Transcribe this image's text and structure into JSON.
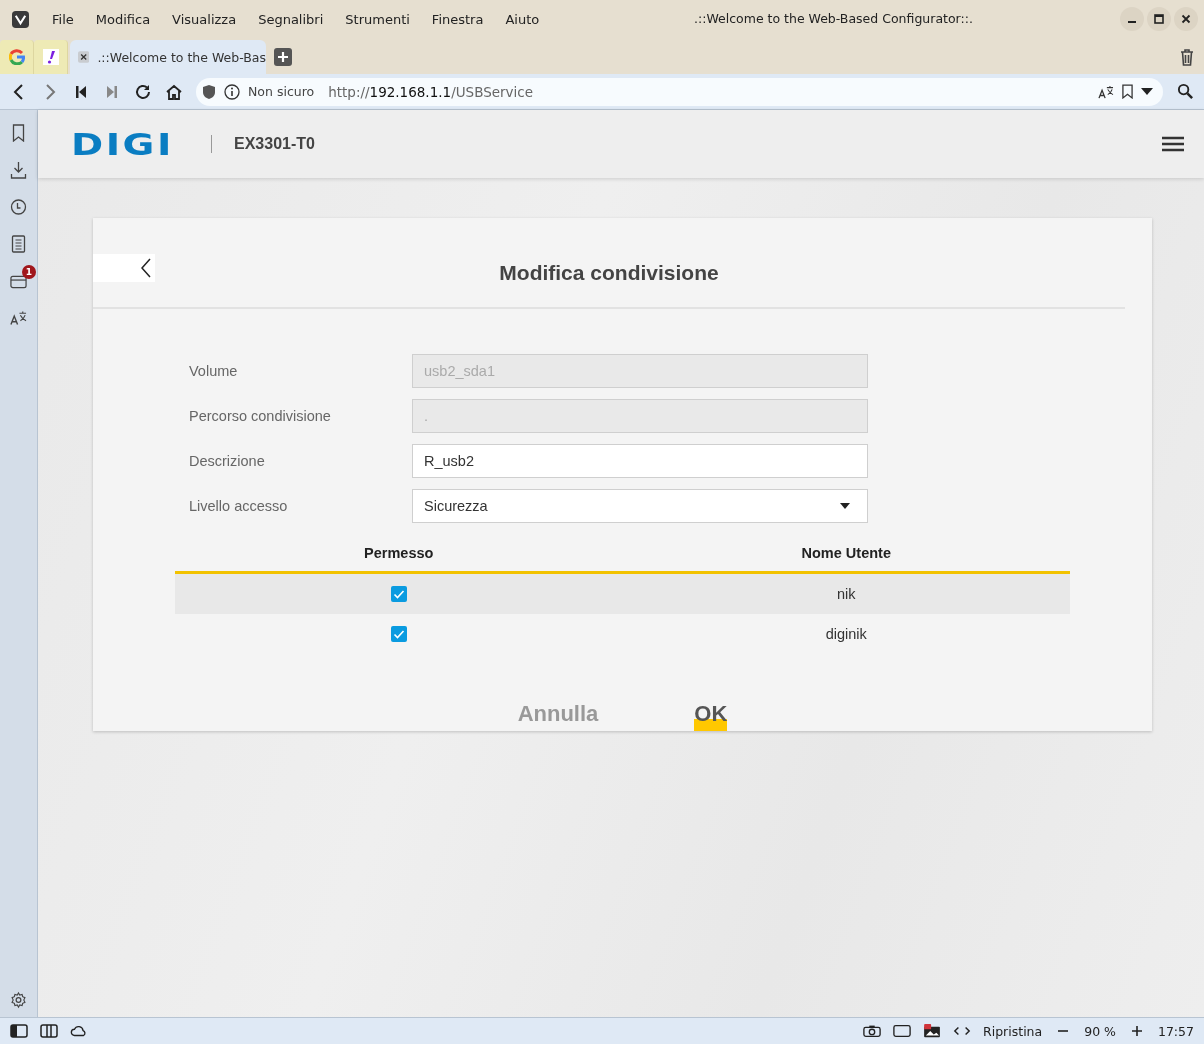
{
  "menu": [
    "File",
    "Modifica",
    "Visualizza",
    "Segnalibri",
    "Strumenti",
    "Finestra",
    "Aiuto"
  ],
  "window_title": ".::Welcome to the Web-Based Configurator::.",
  "tabs": [
    {
      "kind": "pinned",
      "selected": false
    },
    {
      "kind": "pinned",
      "selected": false
    },
    {
      "kind": "page",
      "title": ".::Welcome to the Web-Bas",
      "selected": true
    }
  ],
  "address": {
    "security": "Non sicuro",
    "scheme": "http://",
    "host": "192.168.1.1",
    "path": "/USBService"
  },
  "panel_badge": "1",
  "header": {
    "brand": "DIGI",
    "model": "EX3301-T0"
  },
  "dialog": {
    "title": "Modifica condivisione",
    "fields": [
      {
        "label": "Volume",
        "kind": "text",
        "value": "usb2_sda1",
        "disabled": true
      },
      {
        "label": "Percorso condivisione",
        "kind": "text",
        "value": ".",
        "disabled": true
      },
      {
        "label": "Descrizione",
        "kind": "text",
        "value": "R_usb2",
        "disabled": false
      },
      {
        "label": "Livello accesso",
        "kind": "select",
        "value": "Sicurezza",
        "disabled": false
      }
    ],
    "columns": [
      "Permesso",
      "Nome Utente"
    ],
    "rows": [
      {
        "checked": true,
        "user": "nik",
        "selected": true
      },
      {
        "checked": true,
        "user": "diginik",
        "selected": false
      }
    ],
    "buttons": [
      {
        "label": "Annulla",
        "kind": "cancel"
      },
      {
        "label": "OK",
        "kind": "primary"
      }
    ]
  },
  "status_bar": {
    "reset": "Ripristina",
    "zoom": "90 %",
    "time": "17:57"
  }
}
